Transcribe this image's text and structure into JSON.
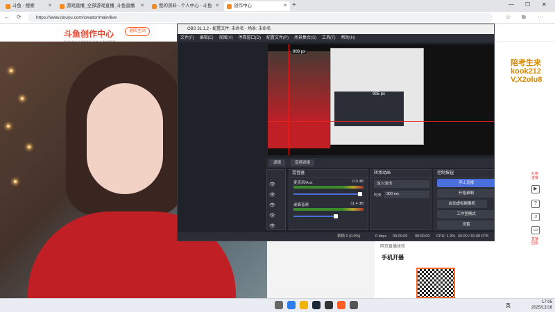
{
  "browser": {
    "tabs": [
      {
        "title": "斗鱼 - 搜索"
      },
      {
        "title": "游戏直播_全部游戏直播_斗鱼直播"
      },
      {
        "title": "我的资料 - 个人中心 - 斗鱼"
      },
      {
        "title": "创作中心"
      }
    ],
    "url": "https://www.douyu.com/creator/main/live"
  },
  "site": {
    "logo": "斗鱼创作中心",
    "logo_sub": "DOUYU CREATION CENTER",
    "back_button": "返回主站"
  },
  "obs": {
    "title": "OBS 31.1.2 - 配置文件: 未命名 - 场景: 未命名",
    "menu": [
      "文件(F)",
      "编辑(E)",
      "视图(V)",
      "停靠窗口(D)",
      "配置文件(P)",
      "场景集合(S)",
      "工具(T)",
      "帮助(H)"
    ],
    "preview_label": "905 px",
    "preview_label_top": "908 px",
    "filter_btn": "滤镜",
    "properties_btn": "音频滤镜",
    "mixer": {
      "header": "混音器",
      "channels": [
        {
          "name": "麦克风/Aux",
          "db": "0.0 dB",
          "level": 0.65
        },
        {
          "name": "桌面音频",
          "db": "-11.4 dB",
          "level": 0.45
        }
      ]
    },
    "transitions": {
      "header": "转场动画",
      "type": "淡入淡出",
      "duration_label": "时长",
      "duration": "300 ms"
    },
    "controls": {
      "header": "控制按钮",
      "buttons": [
        "停止直播",
        "开始录制",
        "启动虚拟摄像机",
        "工作室模式",
        "设置"
      ]
    },
    "status": {
      "dropped": "丢帧 0 (0.0%)",
      "kbps": "0 kbps",
      "stream_time": "00:00:00",
      "rec_time": "00:00:00",
      "cpu": "CPU: 1.9%",
      "fps": "60.00 / 60.00 FPS"
    }
  },
  "overlay_text": {
    "line1": "陪考生来",
    "line2": "kook212",
    "line3": "V,X2olu8"
  },
  "right_sidebar": {
    "items": [
      "礼物连接",
      "直播回看"
    ]
  },
  "lower": {
    "caption": "网页直播体验",
    "mobile_title": "手机开播"
  },
  "taskbar": {
    "time": "17:05",
    "date": "2025/12/16",
    "lang": "英"
  },
  "colors": {
    "accent": "#ff5d23",
    "obs_bg": "#1f2229",
    "stop_btn": "#4a6fdc"
  }
}
